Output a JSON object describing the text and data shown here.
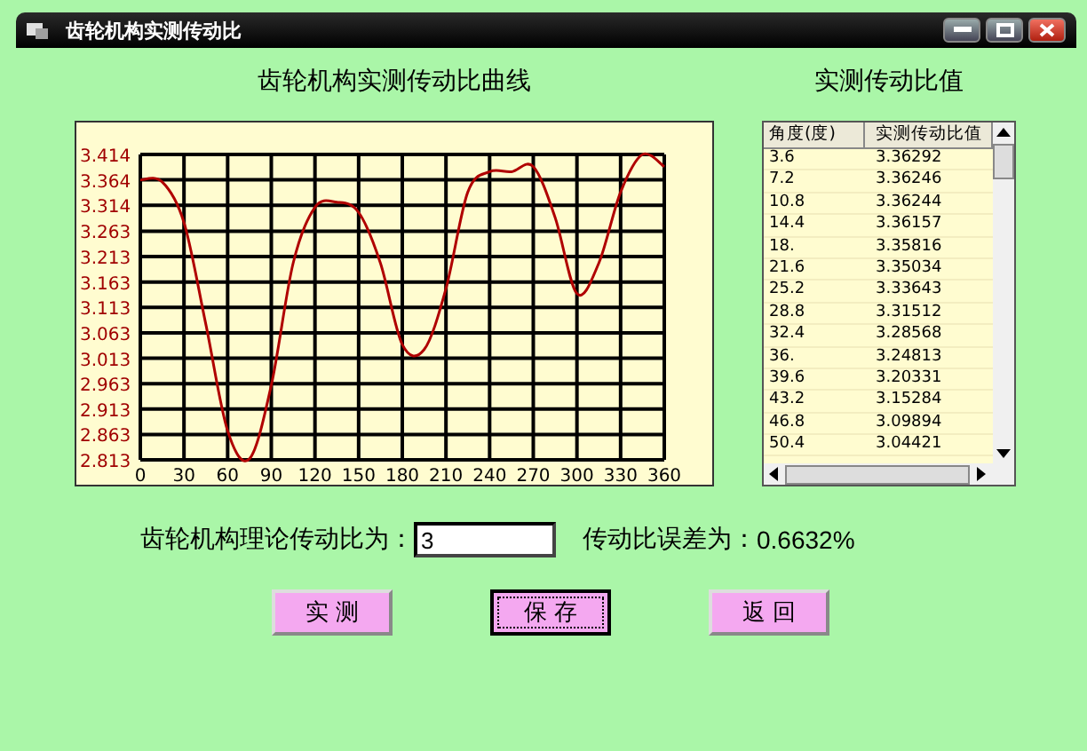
{
  "window": {
    "title": "齿轮机构实测传动比"
  },
  "chart_panel": {
    "title": "齿轮机构实测传动比曲线",
    "chart_data": {
      "type": "line",
      "x": [
        0,
        15,
        30,
        45,
        60,
        75,
        90,
        105,
        120,
        135,
        150,
        165,
        180,
        195,
        210,
        225,
        240,
        255,
        270,
        285,
        300,
        315,
        330,
        345,
        360
      ],
      "grid": true,
      "series": [
        {
          "color": "#b00000",
          "values": [
            3.364,
            3.36,
            3.28,
            3.08,
            2.87,
            2.815,
            2.96,
            3.2,
            3.31,
            3.32,
            3.3,
            3.2,
            3.04,
            3.03,
            3.15,
            3.34,
            3.38,
            3.38,
            3.39,
            3.29,
            3.14,
            3.2,
            3.34,
            3.414,
            3.39
          ]
        }
      ],
      "xlim": [
        0,
        360
      ],
      "ylim": [
        2.813,
        3.414
      ],
      "xticks": [
        0,
        30,
        60,
        90,
        120,
        150,
        180,
        210,
        240,
        270,
        300,
        330,
        360
      ],
      "yticks": [
        2.813,
        2.863,
        2.913,
        2.963,
        3.013,
        3.063,
        3.113,
        3.163,
        3.213,
        3.263,
        3.314,
        3.364,
        3.414
      ]
    }
  },
  "table_panel": {
    "title": "实测传动比值",
    "columns": [
      "角度(度)",
      "实测传动比值"
    ],
    "rows": [
      [
        "3.6",
        "3.36292"
      ],
      [
        "7.2",
        "3.36246"
      ],
      [
        "10.8",
        "3.36244"
      ],
      [
        "14.4",
        "3.36157"
      ],
      [
        "18.",
        "3.35816"
      ],
      [
        "21.6",
        "3.35034"
      ],
      [
        "25.2",
        "3.33643"
      ],
      [
        "28.8",
        "3.31512"
      ],
      [
        "32.4",
        "3.28568"
      ],
      [
        "36.",
        "3.24813"
      ],
      [
        "39.6",
        "3.20331"
      ],
      [
        "43.2",
        "3.15284"
      ],
      [
        "46.8",
        "3.09894"
      ],
      [
        "50.4",
        "3.04421"
      ]
    ]
  },
  "theory_ratio": {
    "label": "齿轮机构理论传动比为：",
    "value": "3"
  },
  "error": {
    "label": "传动比误差为：",
    "value": "0.6632%"
  },
  "buttons": [
    {
      "label": "实 测",
      "focused": false
    },
    {
      "label": "保 存",
      "focused": true
    },
    {
      "label": "返 回",
      "focused": false
    }
  ]
}
